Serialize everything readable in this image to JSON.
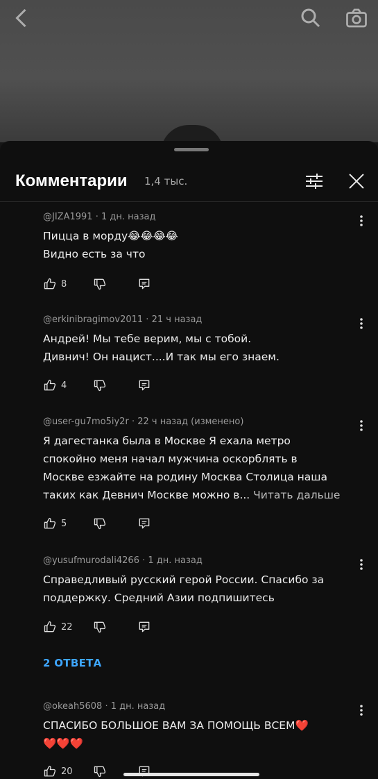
{
  "sheet": {
    "title": "Комментарии",
    "count": "1,4 тыс."
  },
  "comments": [
    {
      "author": "@JIZA1991",
      "time": "1 дн. назад",
      "lines": [
        "Пицца в морду😂😂😂😂",
        "Видно есть за что"
      ],
      "likes": "8"
    },
    {
      "author": "@erkinibragimov2011",
      "time": "21 ч назад",
      "lines": [
        "Андрей! Мы тебе верим, мы с тобой.",
        "Дивнич! Он нацист....И так мы его знаем."
      ],
      "likes": "4"
    },
    {
      "author": "@user-gu7mo5iy2r",
      "time": "22 ч назад (изменено)",
      "lines": [
        "Я дагестанка была в Москве Я ехала метро",
        "спокойно меня начал мужчина оскорблять в",
        "Москве езжайте на родину Москва Столица наша",
        "таких как Девнич Москве можно в..."
      ],
      "read_more": "Читать дальше",
      "likes": "5"
    },
    {
      "author": "@yusufmurodali4266",
      "time": "1 дн. назад",
      "lines": [
        "Справедливый русский герой России. Спасибо за",
        "поддержку.  Средний Азии подпишитесь"
      ],
      "likes": "22",
      "replies": "2 ОТВЕТА"
    },
    {
      "author": "@okeah5608",
      "time": "1 дн. назад",
      "lines": [
        "СПАСИБО БОЛЬШОЕ ВАМ ЗА ПОМОЩЬ ВСЕМ❤️",
        "❤️❤️❤️"
      ],
      "likes": "20"
    }
  ],
  "meta_separator": "·",
  "icons": {
    "back": "chevron-left-icon",
    "search": "search-icon",
    "camera": "camera-icon",
    "filter": "filter-icon",
    "close": "close-icon",
    "like": "thumbs-up-icon",
    "dislike": "thumbs-down-icon",
    "reply": "reply-icon",
    "more": "more-vertical-icon"
  },
  "colors": {
    "link": "#3ea6ff",
    "sheet_bg": "#0f0f0f"
  }
}
